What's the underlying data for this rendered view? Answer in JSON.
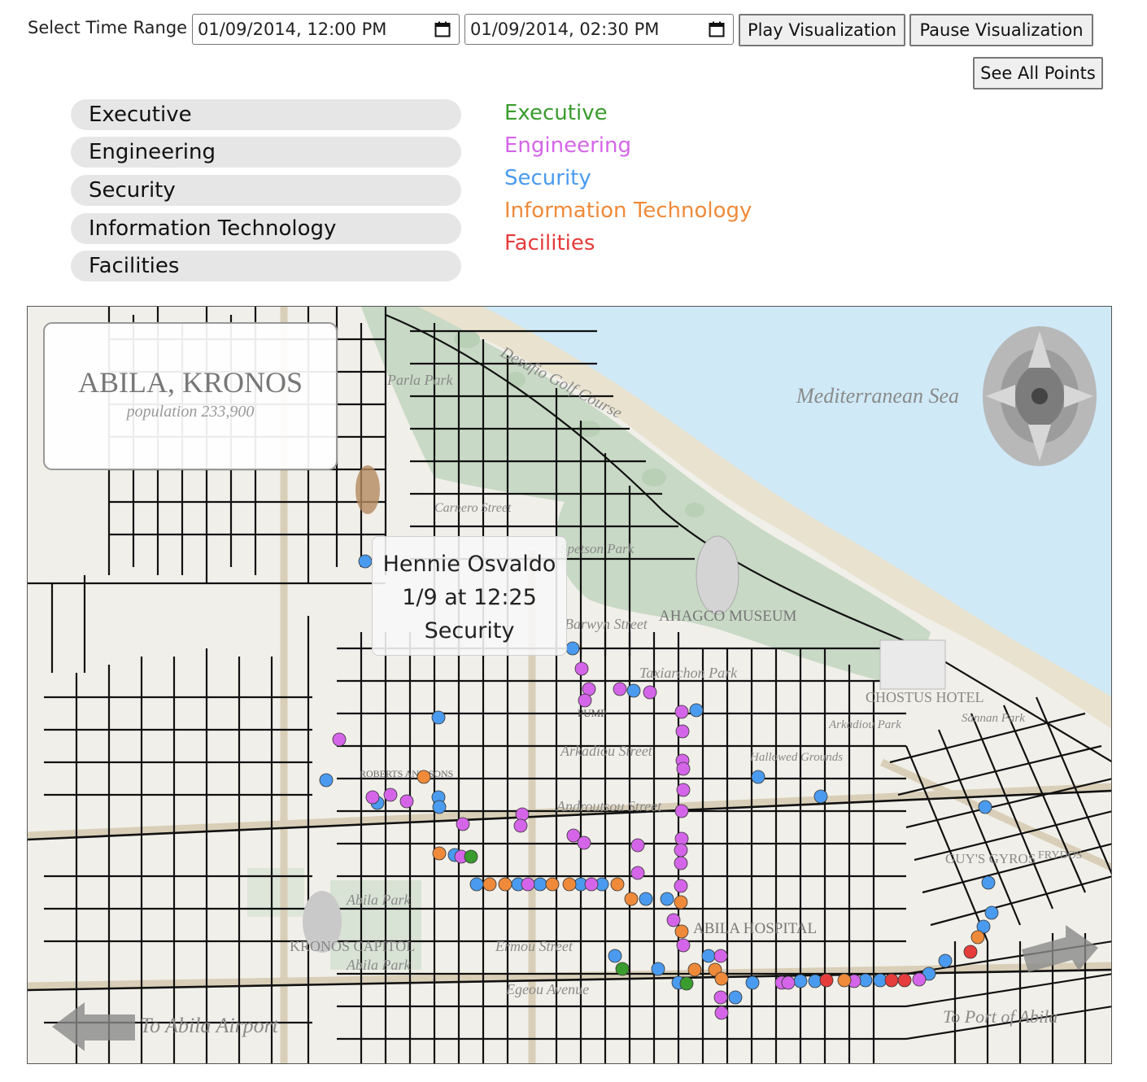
{
  "controls": {
    "range_label": "Select Time Range",
    "start_value": "01/09/2014, 12:00 PM",
    "end_value": "01/09/2014, 02:30 PM",
    "play_label": "Play Visualization",
    "pause_label": "Pause Visualization",
    "see_all_label": "See All Points"
  },
  "filters": [
    "Executive",
    "Engineering",
    "Security",
    "Information Technology",
    "Facilities"
  ],
  "legend": [
    {
      "label": "Executive",
      "color": "#3a9c2e"
    },
    {
      "label": "Engineering",
      "color": "#d465e8"
    },
    {
      "label": "Security",
      "color": "#4a9bef"
    },
    {
      "label": "Information Technology",
      "color": "#ef8a3a"
    },
    {
      "label": "Facilities",
      "color": "#e53c3c"
    }
  ],
  "map": {
    "city_title": "ABILA, KRONOS",
    "population": "population 233,900",
    "labels": {
      "golf": "Desafio Golf Course",
      "sea": "Mediterranean Sea",
      "museum": "AHAGCO MUSEUM",
      "taxiarchon": "Taxiarchon Park",
      "chostus": "CHOSTUS HOTEL",
      "hospital": "ABILA HOSPITAL",
      "abila_park_1": "Abila Park",
      "abila_park_2": "Abila Park",
      "capitol": "KRONOS CAPITOL",
      "airport": "To Abila Airport",
      "port": "To Port of Abila",
      "arkadiou": "Arkadiou Street",
      "androutsou": "Androutsou Street",
      "ermou": "Ermou Street",
      "egeou": "Egeou Avenue",
      "parla": "Parla Park",
      "carnero": "Carnero Street",
      "spetson_park": "Spetson Park",
      "barwyn": "Barwyn Street",
      "guys": "GUY'S GYROS",
      "frydos": "FRYDOS",
      "pump": "PUMP",
      "roberts": "ROBERTS AND SONS",
      "hallowed": "Hallowed Grounds",
      "sannan": "Sannan Park",
      "arkadiou_park": "Arkadiou Park"
    }
  },
  "tooltip": {
    "name": "Hennie Osvaldo",
    "time": "1/9 at 12:25",
    "department": "Security"
  }
}
